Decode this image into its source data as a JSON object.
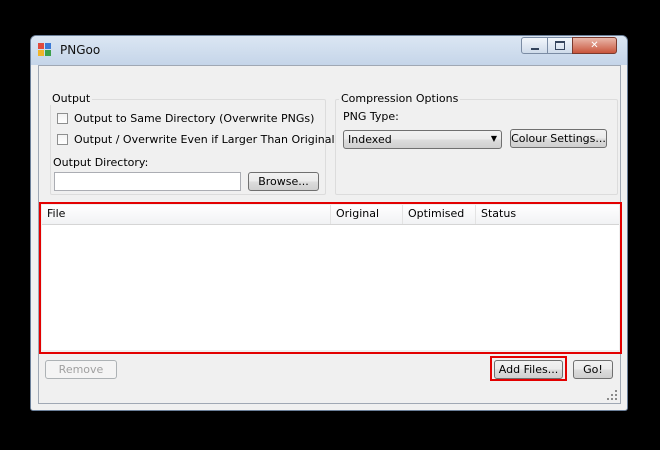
{
  "window": {
    "title": "PNGoo"
  },
  "icons": {
    "app": "pngoo-app-icon",
    "minimize": "minimize-icon",
    "maximize": "maximize-icon",
    "close": "close-icon",
    "dropdown": "chevron-down-icon",
    "resize": "resize-grip-icon"
  },
  "output": {
    "group_title": "Output",
    "same_dir_label": "Output to Same Directory (Overwrite PNGs)",
    "same_dir_checked": false,
    "overwrite_label": "Output / Overwrite Even if Larger Than Original",
    "overwrite_checked": false,
    "dir_label": "Output Directory:",
    "dir_value": "",
    "browse_label": "Browse..."
  },
  "compression": {
    "group_title": "Compression Options",
    "png_type_label": "PNG Type:",
    "png_type_value": "Indexed",
    "colour_settings_label": "Colour Settings..."
  },
  "file_list": {
    "columns": [
      "File",
      "Original",
      "Optimised",
      "Status"
    ],
    "rows": []
  },
  "actions": {
    "remove_label": "Remove",
    "add_files_label": "Add Files...",
    "go_label": "Go!"
  },
  "colors": {
    "highlight_border": "#e30000",
    "titlebar": "#c5d5e9",
    "window_bg": "#f0f0f0"
  }
}
